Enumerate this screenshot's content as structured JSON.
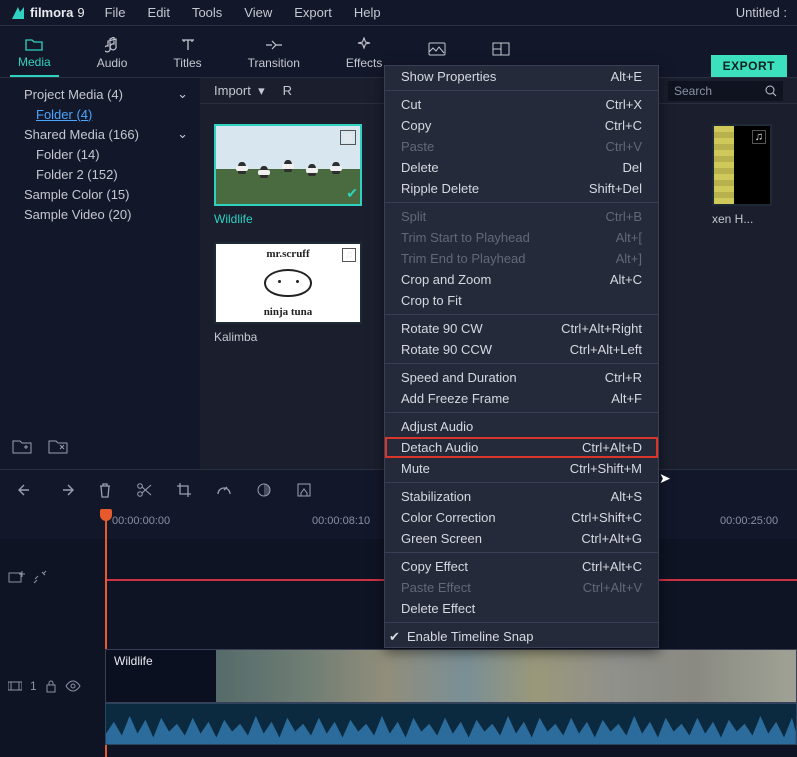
{
  "app": {
    "name": "filmora",
    "version": "9",
    "project_title": "Untitled :"
  },
  "menu": {
    "file": "File",
    "edit": "Edit",
    "tools": "Tools",
    "view": "View",
    "export": "Export",
    "help": "Help"
  },
  "tabs": {
    "media": "Media",
    "audio": "Audio",
    "titles": "Titles",
    "transition": "Transition",
    "effects": "Effects",
    "export_btn": "EXPORT"
  },
  "sidebar": {
    "rows": [
      {
        "label": "Project Media (4)",
        "indent": 0,
        "expand": true
      },
      {
        "label": "Folder (4)",
        "indent": 1,
        "link": true
      },
      {
        "label": "Shared Media (166)",
        "indent": 0,
        "expand": true
      },
      {
        "label": "Folder (14)",
        "indent": 1
      },
      {
        "label": "Folder 2 (152)",
        "indent": 1
      },
      {
        "label": "Sample Color (15)",
        "indent": 0
      },
      {
        "label": "Sample Video (20)",
        "indent": 0
      }
    ]
  },
  "browser": {
    "import": "Import",
    "record": "R",
    "search_placeholder": "Search",
    "thumbs": [
      {
        "label": "Wildlife",
        "selected": true,
        "badge": "grid"
      },
      {
        "label": "Kalimba",
        "badge": "audio"
      },
      {
        "label": "xen H...",
        "badge": "audio",
        "partial": true
      }
    ]
  },
  "timeline": {
    "ticks": [
      "00:00:00:00",
      "00:00:08:10",
      "00:00:25:00"
    ],
    "clip_label": "Wildlife",
    "track_number": "1"
  },
  "context_menu": {
    "items": [
      {
        "label": "Show Properties",
        "accel": "Alt+E"
      },
      {
        "sep": true
      },
      {
        "label": "Cut",
        "accel": "Ctrl+X"
      },
      {
        "label": "Copy",
        "accel": "Ctrl+C"
      },
      {
        "label": "Paste",
        "accel": "Ctrl+V",
        "disabled": true
      },
      {
        "label": "Delete",
        "accel": "Del"
      },
      {
        "label": "Ripple Delete",
        "accel": "Shift+Del"
      },
      {
        "sep": true
      },
      {
        "label": "Split",
        "accel": "Ctrl+B",
        "disabled": true
      },
      {
        "label": "Trim Start to Playhead",
        "accel": "Alt+[",
        "disabled": true
      },
      {
        "label": "Trim End to Playhead",
        "accel": "Alt+]",
        "disabled": true
      },
      {
        "label": "Crop and Zoom",
        "accel": "Alt+C"
      },
      {
        "label": "Crop to Fit"
      },
      {
        "sep": true
      },
      {
        "label": "Rotate 90 CW",
        "accel": "Ctrl+Alt+Right"
      },
      {
        "label": "Rotate 90 CCW",
        "accel": "Ctrl+Alt+Left"
      },
      {
        "sep": true
      },
      {
        "label": "Speed and Duration",
        "accel": "Ctrl+R"
      },
      {
        "label": "Add Freeze Frame",
        "accel": "Alt+F"
      },
      {
        "sep": true
      },
      {
        "label": "Adjust Audio"
      },
      {
        "label": "Detach Audio",
        "accel": "Ctrl+Alt+D",
        "highlight": true
      },
      {
        "label": "Mute",
        "accel": "Ctrl+Shift+M"
      },
      {
        "sep": true
      },
      {
        "label": "Stabilization",
        "accel": "Alt+S"
      },
      {
        "label": "Color Correction",
        "accel": "Ctrl+Shift+C"
      },
      {
        "label": "Green Screen",
        "accel": "Ctrl+Alt+G"
      },
      {
        "sep": true
      },
      {
        "label": "Copy Effect",
        "accel": "Ctrl+Alt+C"
      },
      {
        "label": "Paste Effect",
        "accel": "Ctrl+Alt+V",
        "disabled": true
      },
      {
        "label": "Delete Effect"
      },
      {
        "sep": true
      },
      {
        "label": "Enable Timeline Snap",
        "checked": true
      }
    ]
  }
}
